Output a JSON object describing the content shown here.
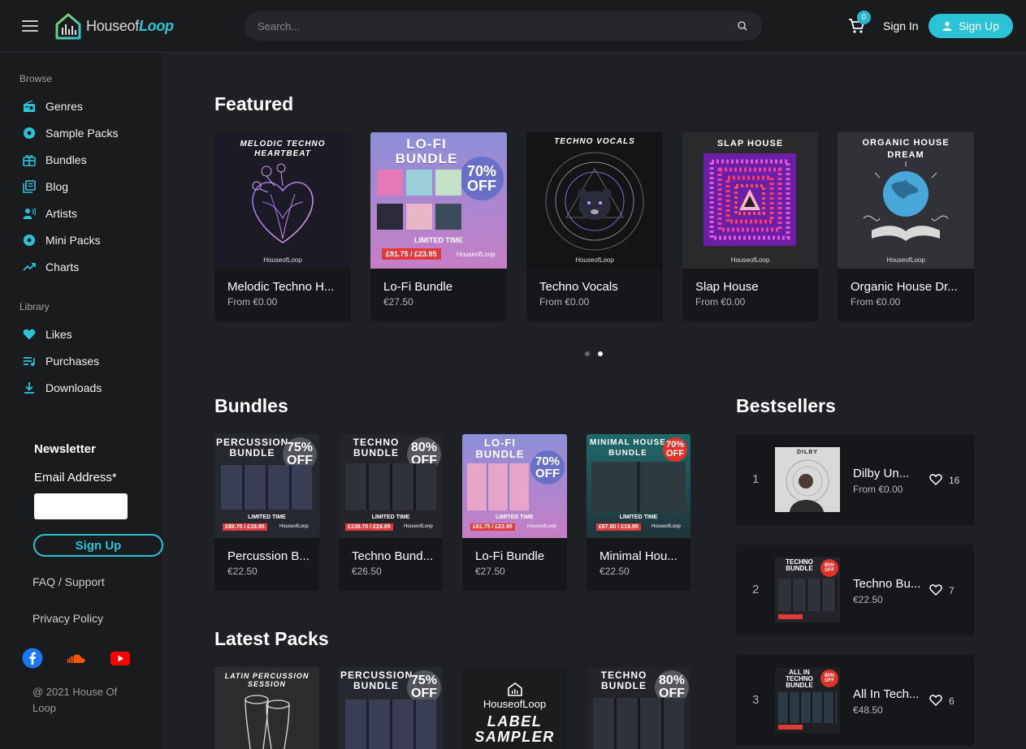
{
  "brand": {
    "name_prefix": "Houseof",
    "name_suffix": "Loop"
  },
  "search": {
    "placeholder": "Search..."
  },
  "header": {
    "cart_count": "0",
    "sign_in": "Sign In",
    "sign_up": "Sign Up"
  },
  "sidebar": {
    "browse_heading": "Browse",
    "browse": [
      {
        "label": "Genres",
        "icon": "radio-icon"
      },
      {
        "label": "Sample Packs",
        "icon": "disc-icon"
      },
      {
        "label": "Bundles",
        "icon": "gift-icon"
      },
      {
        "label": "Blog",
        "icon": "library-icon"
      },
      {
        "label": "Artists",
        "icon": "artist-icon"
      },
      {
        "label": "Mini Packs",
        "icon": "disc-icon"
      },
      {
        "label": "Charts",
        "icon": "trending-icon"
      }
    ],
    "library_heading": "Library",
    "library": [
      {
        "label": "Likes",
        "icon": "heart-icon"
      },
      {
        "label": "Purchases",
        "icon": "playlist-icon"
      },
      {
        "label": "Downloads",
        "icon": "download-icon"
      }
    ],
    "newsletter_title": "Newsletter",
    "email_label": "Email Address*",
    "newsletter_button": "Sign Up",
    "faq": "FAQ / Support",
    "privacy": "Privacy Policy",
    "copyright": "@ 2021 House Of Loop",
    "accent": "#2bc4d6"
  },
  "featured": {
    "title": "Featured",
    "items": [
      {
        "name": "Melodic Techno H...",
        "price": "From €0.00",
        "art_title": "MELODIC TECHNO HEARTBEAT",
        "logo": "HouseofLoop"
      },
      {
        "name": "Lo-Fi Bundle",
        "price": "€27.50",
        "art_title": "LO-FI BUNDLE",
        "badge_top": "70%",
        "badge_bottom": "OFF",
        "limited": "LIMITED TIME",
        "deal": "£91.75 / £23.95",
        "logo": "HouseofLoop"
      },
      {
        "name": "Techno Vocals",
        "price": "From €0.00",
        "art_title": "TECHNO VOCALS",
        "logo": "HouseofLoop"
      },
      {
        "name": "Slap House",
        "price": "From €0.00",
        "art_title": "SLAP HOUSE",
        "logo": "HouseofLoop"
      },
      {
        "name": "Organic House Dr...",
        "price": "From €0.00",
        "art_title": "ORGANIC HOUSE DREAM",
        "logo": "HouseofLoop"
      }
    ]
  },
  "bundles": {
    "title": "Bundles",
    "items": [
      {
        "name": "Percussion B...",
        "price": "€22.50",
        "art_title": "PERCUSSION BUNDLE",
        "badge_top": "75%",
        "badge_bottom": "OFF",
        "limited": "LIMITED TIME",
        "deal": "£89.70 / £19.95",
        "logo": "HouseofLoop"
      },
      {
        "name": "Techno Bund...",
        "price": "€26.50",
        "art_title": "TECHNO BUNDLE",
        "badge_top": "80%",
        "badge_bottom": "OFF",
        "limited": "LIMITED TIME",
        "deal": "£139.70 / £24.95",
        "logo": "HouseofLoop"
      },
      {
        "name": "Lo-Fi Bundle",
        "price": "€27.50",
        "art_title": "LO-FI BUNDLE",
        "badge_top": "70%",
        "badge_bottom": "OFF",
        "limited": "LIMITED TIME",
        "deal": "£81.75 / £23.95",
        "logo": "HouseofLoop"
      },
      {
        "name": "Minimal Hou...",
        "price": "€22.50",
        "art_title": "MINIMAL HOUSE BUNDLE",
        "badge_top": "70%",
        "badge_bottom": "OFF",
        "limited": "LIMITED TIME",
        "deal": "£67.80 / £19.95",
        "logo": "HouseofLoop"
      }
    ]
  },
  "latest": {
    "title": "Latest Packs",
    "items": [
      {
        "art_title": "LATIN PERCUSSION SESSION"
      },
      {
        "art_title": "PERCUSSION BUNDLE",
        "badge_top": "75%",
        "badge_bottom": "OFF"
      },
      {
        "art_title": "LABEL SAMPLER",
        "logo": "HouseofLoop"
      },
      {
        "art_title": "TECHNO BUNDLE",
        "badge_top": "80%",
        "badge_bottom": "OFF"
      }
    ]
  },
  "bestsellers": {
    "title": "Bestsellers",
    "items": [
      {
        "rank": "1",
        "name": "Dilby Un...",
        "price": "From €0.00",
        "likes": "16",
        "art_title": "DILBY"
      },
      {
        "rank": "2",
        "name": "Techno Bu...",
        "price": "€22.50",
        "likes": "7",
        "art_title": "TECHNO BUNDLE",
        "badge_top": "85%",
        "badge_bottom": "OFF"
      },
      {
        "rank": "3",
        "name": "All In Tech...",
        "price": "€48.50",
        "likes": "6",
        "art_title": "ALL IN TECHNO BUNDLE",
        "badge_top": "80%",
        "badge_bottom": "OFF"
      }
    ]
  }
}
